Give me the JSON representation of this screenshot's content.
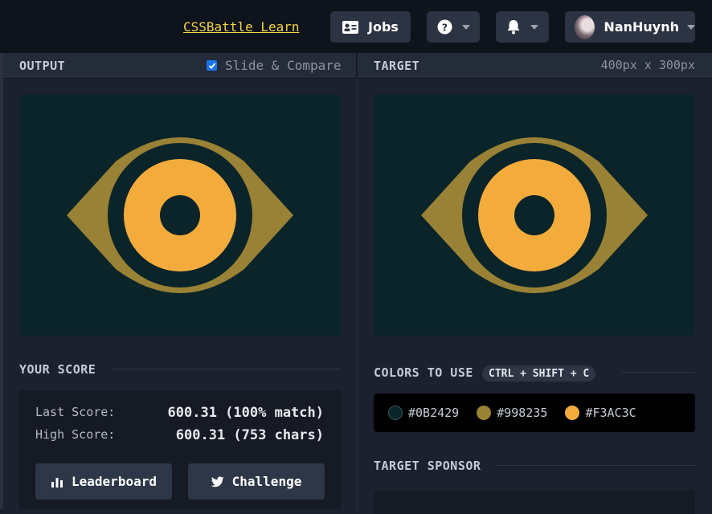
{
  "topbar": {
    "learn_link": "CSSBattle Learn",
    "jobs_label": "Jobs",
    "username": "NanHuynh"
  },
  "output_panel": {
    "title": "OUTPUT",
    "slide_compare_label": "Slide & Compare",
    "slide_compare_checked": true
  },
  "target_panel": {
    "title": "TARGET",
    "dimensions": "400px x 300px"
  },
  "score": {
    "title": "YOUR SCORE",
    "last_label": "Last Score:",
    "last_value": "600.31 (100% match)",
    "high_label": "High Score:",
    "high_value": "600.31 (753 chars)",
    "leaderboard_label": "Leaderboard",
    "challenge_label": "Challenge"
  },
  "colors": {
    "title": "COLORS TO USE",
    "shortcut": "CTRL + SHIFT + C",
    "items": [
      {
        "code": "#0B2429",
        "hex": "#0B2429"
      },
      {
        "code": "#998235",
        "hex": "#998235"
      },
      {
        "code": "#F3AC3C",
        "hex": "#F3AC3C"
      }
    ]
  },
  "sponsor": {
    "title": "TARGET SPONSOR"
  }
}
